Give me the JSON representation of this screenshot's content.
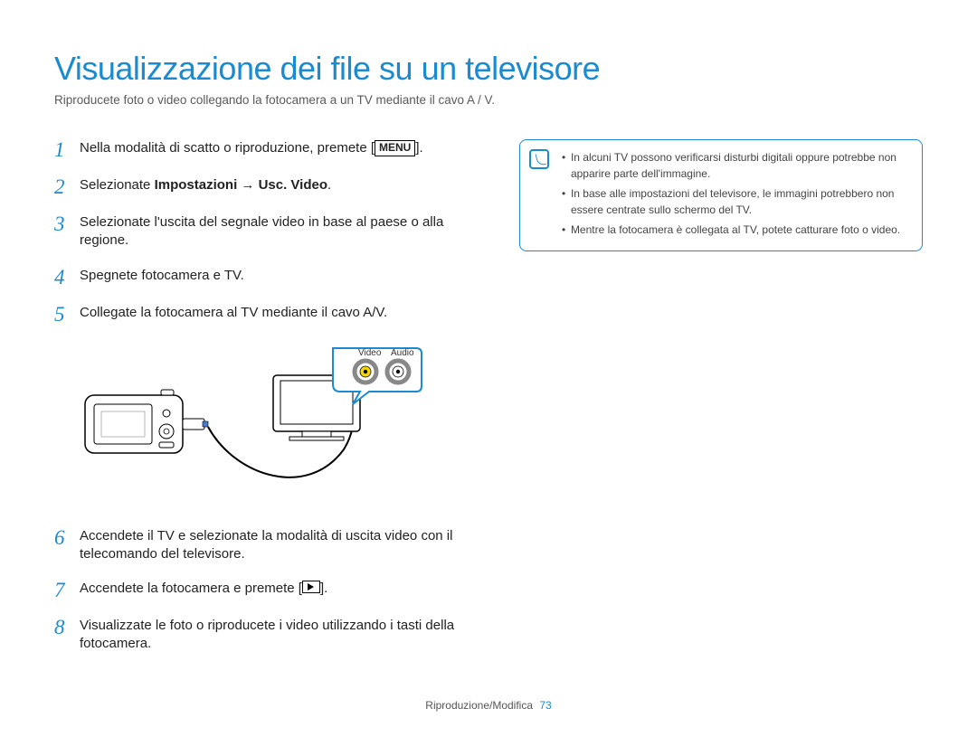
{
  "title": "Visualizzazione dei file su un televisore",
  "subtitle": "Riproducete foto o video collegando la fotocamera a un TV mediante il cavo A / V.",
  "steps": {
    "s1_pre": "Nella modalità di scatto o riproduzione, premete [",
    "s1_btn": "MENU",
    "s1_post": "].",
    "s2_pre": "Selezionate ",
    "s2_bold": "Impostazioni → Usc. Video",
    "s2_post": ".",
    "s3": "Selezionate l'uscita del segnale video in base al paese o alla regione.",
    "s4": "Spegnete fotocamera e TV.",
    "s5": "Collegate la fotocamera al TV mediante il cavo A/V.",
    "s6": "Accendete il TV e selezionate la modalità di uscita video con il telecomando del televisore.",
    "s7_pre": "Accendete la fotocamera e premete [",
    "s7_post": "].",
    "s8": "Visualizzate le foto o riproducete i video utilizzando i tasti della fotocamera."
  },
  "diagram": {
    "video_label": "Video",
    "audio_label": "Audio"
  },
  "info": {
    "b1": "In alcuni TV possono verificarsi disturbi digitali oppure potrebbe non apparire parte dell'immagine.",
    "b2": "In base alle impostazioni del televisore, le immagini potrebbero non essere centrate sullo schermo del TV.",
    "b3": "Mentre la fotocamera è collegata al TV, potete catturare foto o video."
  },
  "footer": {
    "section": "Riproduzione/Modifica",
    "page": "73"
  }
}
